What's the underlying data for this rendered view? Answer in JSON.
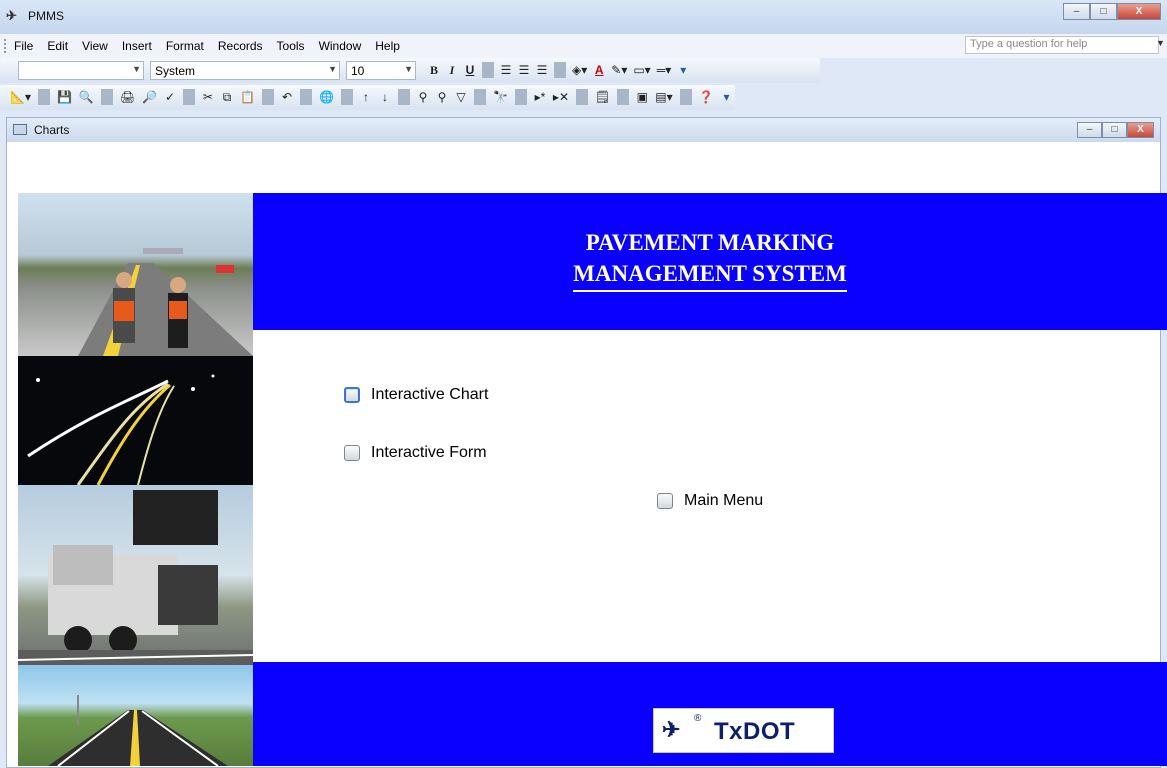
{
  "window": {
    "title": "PMMS",
    "controls": {
      "minimize": "–",
      "maximize": "□",
      "close": "X"
    }
  },
  "menubar": {
    "items": [
      "File",
      "Edit",
      "View",
      "Insert",
      "Format",
      "Records",
      "Tools",
      "Window",
      "Help"
    ],
    "help_placeholder": "Type a question for help"
  },
  "format_toolbar": {
    "object_combo": "",
    "font_combo": "System",
    "size_combo": "10",
    "bold": "B",
    "italic": "I",
    "underline": "U",
    "font_color": "A"
  },
  "child_window": {
    "title": "Charts"
  },
  "form": {
    "banner_line1": "PAVEMENT MARKING",
    "banner_line2": "MANAGEMENT SYSTEM",
    "options": {
      "interactive_chart": "Interactive Chart",
      "interactive_form": "Interactive Form",
      "main_menu": "Main Menu"
    },
    "logo_text": "TxDOT",
    "logo_reg": "®"
  },
  "colors": {
    "banner_blue": "#0a00ff",
    "logo_navy": "#0b1f6b",
    "focus_blue": "#3b78c4"
  },
  "icons": [
    "app-logo-icon",
    "form-icon",
    "save-icon",
    "print-icon",
    "undo-icon",
    "find-icon",
    "help-icon"
  ]
}
